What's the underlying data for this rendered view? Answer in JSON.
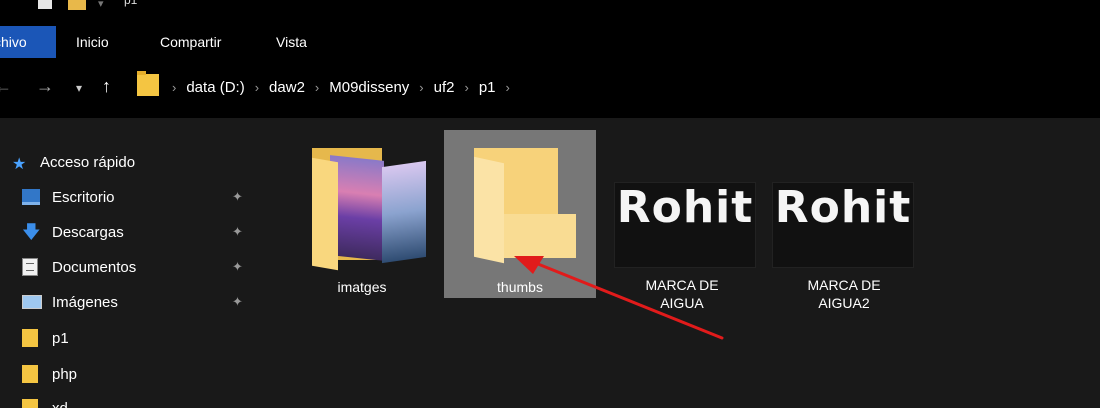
{
  "titlebar": {
    "path_fragment": "p1"
  },
  "ribbon": {
    "tabs": [
      {
        "label": "chivo"
      },
      {
        "label": "Inicio"
      },
      {
        "label": "Compartir"
      },
      {
        "label": "Vista"
      }
    ]
  },
  "navigation": {
    "back_icon": "arrow-left-icon",
    "forward_icon": "arrow-right-icon",
    "recent_icon": "chevron-down-icon",
    "up_icon": "arrow-up-icon"
  },
  "breadcrumb": [
    "data (D:)",
    "daw2",
    "M09disseny",
    "uf2",
    "p1"
  ],
  "sidebar": {
    "quick_access": "Acceso rápido",
    "items": [
      {
        "label": "Escritorio",
        "icon": "desktop-icon",
        "pinned": true
      },
      {
        "label": "Descargas",
        "icon": "download-icon",
        "pinned": true
      },
      {
        "label": "Documentos",
        "icon": "document-icon",
        "pinned": true
      },
      {
        "label": "Imágenes",
        "icon": "pictures-icon",
        "pinned": true
      },
      {
        "label": "p1",
        "icon": "folder-icon",
        "pinned": false
      },
      {
        "label": "php",
        "icon": "folder-icon",
        "pinned": false
      },
      {
        "label": "xd",
        "icon": "folder-icon",
        "pinned": false
      }
    ]
  },
  "files": [
    {
      "name": "imatges",
      "type": "folder-with-photos"
    },
    {
      "name": "thumbs",
      "type": "folder",
      "selected": true
    },
    {
      "name_line1": "MARCA DE",
      "name_line2": "AIGUA",
      "type": "image",
      "preview_text": "Rohit"
    },
    {
      "name_line1": "MARCA DE",
      "name_line2": "AIGUA2",
      "type": "image",
      "preview_text": "Rohit"
    }
  ],
  "annotation": {
    "arrow_color": "#e11b1b"
  },
  "colors": {
    "accent": "#1b56b7",
    "selection": "#777777",
    "background": "#191919"
  }
}
